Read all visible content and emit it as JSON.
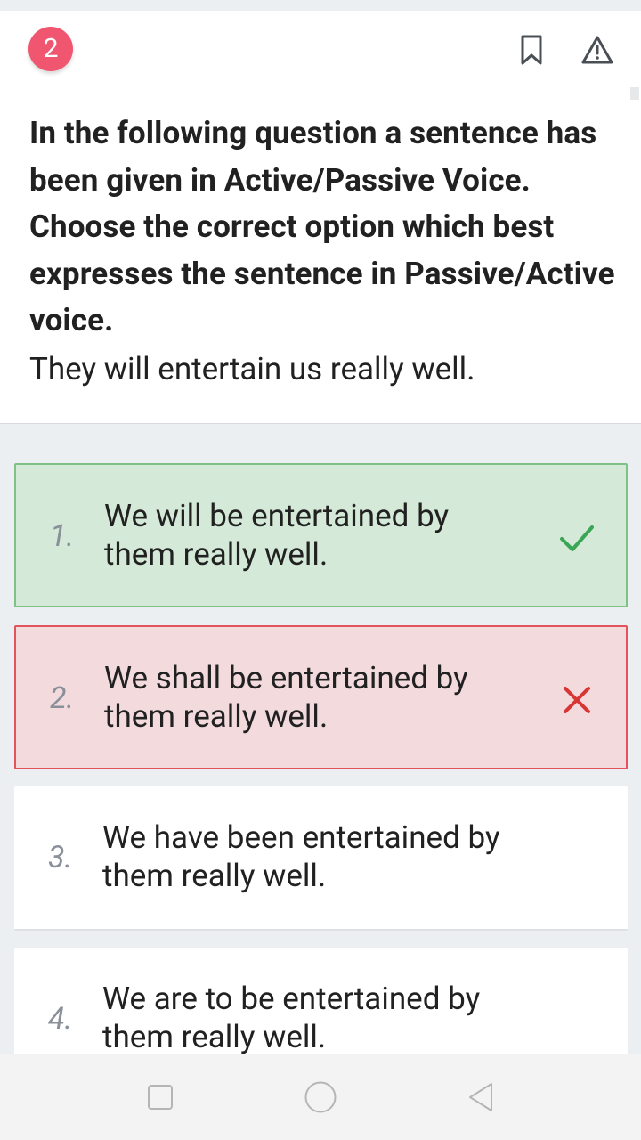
{
  "question": {
    "number": "2",
    "instruction": "In the following question a sentence has been given in Active/Passive Voice. Choose the correct option which best expresses the sentence in Passive/Active voice.",
    "sentence": "They will entertain us really well."
  },
  "icons": {
    "bookmark": "bookmark-icon",
    "report": "warning-triangle-icon",
    "correct": "check-icon",
    "wrong": "cross-icon"
  },
  "colors": {
    "badge": "#f0566f",
    "correct_bg": "#d4e9d7",
    "correct_border": "#7fc286",
    "correct_mark": "#3aa655",
    "wrong_bg": "#f2dadd",
    "wrong_border": "#e2535c",
    "wrong_mark": "#d83535"
  },
  "options": [
    {
      "num": "1.",
      "text": "We will be entertained by them really well.",
      "state": "correct"
    },
    {
      "num": "2.",
      "text": "We shall be entertained by them really well.",
      "state": "wrong"
    },
    {
      "num": "3.",
      "text": "We have been entertained by them really well.",
      "state": "none"
    },
    {
      "num": "4.",
      "text": "We are to be entertained by them really well.",
      "state": "none"
    }
  ],
  "navbar": {
    "recents": "square-icon",
    "home": "circle-icon",
    "back": "triangle-back-icon"
  }
}
